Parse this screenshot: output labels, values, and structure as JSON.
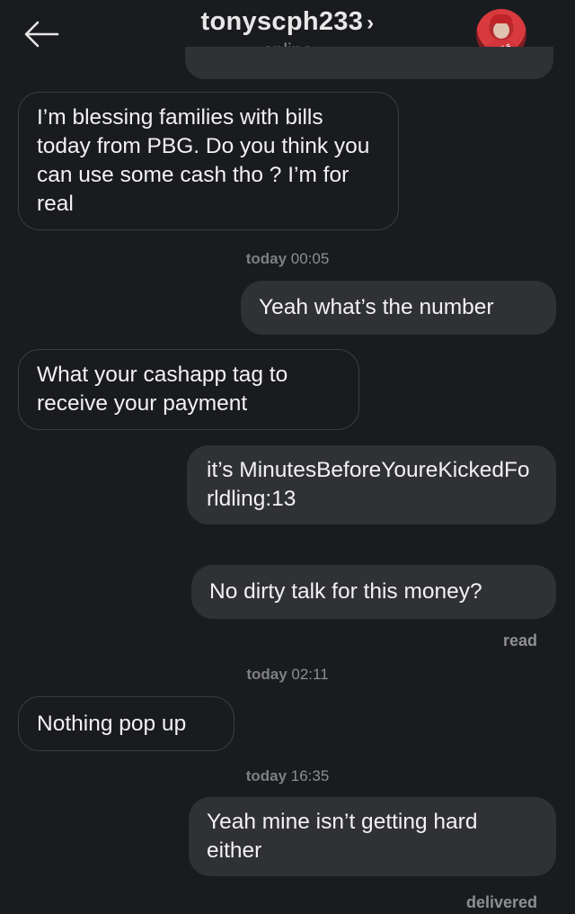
{
  "header": {
    "username": "tonyscph233",
    "chevron": "›",
    "status": "online",
    "back_icon": "arrow-left-icon",
    "avatar_text": "ANGELS"
  },
  "messages": [
    {
      "direction": "in",
      "text": "I’m blessing families with bills today from PBG. Do you think you can use some cash tho ? I’m for real"
    },
    {
      "type": "time",
      "day": "today",
      "time": "00:05"
    },
    {
      "direction": "out",
      "text": "Yeah what’s the number"
    },
    {
      "direction": "in",
      "text": "What your cashapp tag to receive your payment"
    },
    {
      "direction": "out",
      "text": "it’s MinutesBeforeYoureKickedFo rldling:13"
    },
    {
      "direction": "out",
      "text": "No dirty talk for this money?"
    },
    {
      "type": "receipt",
      "text": "read"
    },
    {
      "type": "time",
      "day": "today",
      "time": "02:11"
    },
    {
      "direction": "in",
      "text": "Nothing pop up"
    },
    {
      "type": "time",
      "day": "today",
      "time": "16:35"
    },
    {
      "direction": "out",
      "text": "Yeah mine isn’t getting hard either"
    },
    {
      "type": "receipt",
      "text": "delivered"
    }
  ],
  "colors": {
    "background": "#1a1b1f",
    "outgoing_bubble": "#303135",
    "incoming_border": "#3c3d42",
    "muted_text": "#8c8d92"
  }
}
